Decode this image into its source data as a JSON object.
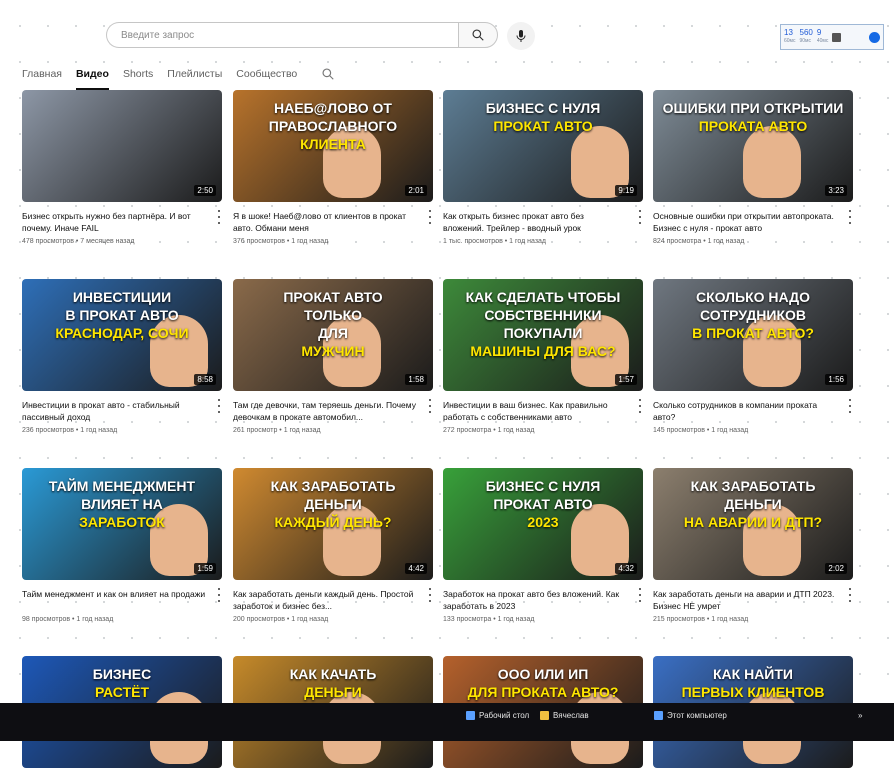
{
  "search": {
    "placeholder": "Введите запрос"
  },
  "tray": {
    "stats": [
      {
        "value": "13",
        "label": "60мс"
      },
      {
        "value": "560",
        "label": "90мс"
      },
      {
        "value": "9",
        "label": "40мс"
      }
    ]
  },
  "tabs": [
    {
      "label": "Главная",
      "active": false
    },
    {
      "label": "Видео",
      "active": true
    },
    {
      "label": "Shorts",
      "active": false
    },
    {
      "label": "Плейлисты",
      "active": false
    },
    {
      "label": "Сообщество",
      "active": false
    }
  ],
  "videos": [
    {
      "thumb_lines": [],
      "duration": "2:50",
      "title": "Бизнес открыть нужно без партнёра. И вот почему. Иначе FAIL",
      "meta": "478 просмотров • 7 месяцев назад",
      "bg": "#8d97a6"
    },
    {
      "thumb_lines": [
        "НАЕБ@ЛОВО ОТ",
        "ПРАВОСЛАВНОГО",
        "КЛИЕНТА"
      ],
      "duration": "2:01",
      "title": "Я в шоке! Наеб@ловo от клиентов в прокат авто. Обмани меня",
      "meta": "376 просмотров • 1 год назад",
      "bg": "#b8732b"
    },
    {
      "thumb_lines": [
        "БИЗНЕС С НУЛЯ",
        "ПРОКАТ АВТО"
      ],
      "duration": "9:19",
      "title": "Как открыть бизнес прокат авто без вложений. Трейлер - вводный урок",
      "meta": "1 тыс. просмотров • 1 год назад",
      "bg": "#5d7d94"
    },
    {
      "thumb_lines": [
        "ОШИБКИ ПРИ ОТКРЫТИИ",
        "ПРОКАТА АВТО"
      ],
      "duration": "3:23",
      "title": "Основные ошибки при открытии автопроката. Бизнес с нуля - прокат авто",
      "meta": "824 просмотра • 1 год назад",
      "bg": "#7e8b96"
    },
    {
      "thumb_lines": [
        "ИНВЕСТИЦИИ",
        "В ПРОКАТ АВТО",
        "КРАСНОДАР, СОЧИ"
      ],
      "duration": "8:58",
      "title": "Инвестиции в прокат авто - стабильный пассивный доход",
      "meta": "236 просмотров • 1 год назад",
      "bg": "#2e6fb8"
    },
    {
      "thumb_lines": [
        "ПРОКАТ АВТО",
        "ТОЛЬКО",
        "ДЛЯ",
        "МУЖЧИН"
      ],
      "duration": "1:58",
      "title": "Там где девочки, там теряешь деньги. Почему девочкам в прокате автомобил...",
      "meta": "261 просмотр • 1 год назад",
      "bg": "#8a6a4a"
    },
    {
      "thumb_lines": [
        "КАК СДЕЛАТЬ ЧТОБЫ",
        "СОБСТВЕННИКИ",
        "ПОКУПАЛИ",
        "МАШИНЫ ДЛЯ ВАС?"
      ],
      "duration": "1:57",
      "title": "Инвестиции в ваш бизнес. Как правильно работать с собственниками авто",
      "meta": "272 просмотра • 1 год назад",
      "bg": "#3d8a3a"
    },
    {
      "thumb_lines": [
        "СКОЛЬКО НАДО",
        "СОТРУДНИКОВ",
        "В ПРОКАТ АВТО?"
      ],
      "duration": "1:56",
      "title": "Сколько сотрудников в компании проката авто?",
      "meta": "145 просмотров • 1 год назад",
      "bg": "#6f7780"
    },
    {
      "thumb_lines": [
        "ТАЙМ МЕНЕДЖМЕНТ",
        "ВЛИЯЕТ НА",
        "ЗАРАБОТОК"
      ],
      "duration": "1:59",
      "title": "Тайм менеджмент и как он влияет на продажи",
      "meta": "98 просмотров • 1 год назад",
      "bg": "#2a9ad6"
    },
    {
      "thumb_lines": [
        "КАК ЗАРАБОТАТЬ",
        "ДЕНЬГИ",
        "КАЖДЫЙ ДЕНЬ?"
      ],
      "duration": "4:42",
      "title": "Как заработать деньги каждый день. Простой заработок и бизнес без...",
      "meta": "200 просмотров • 1 год назад",
      "bg": "#d08a30"
    },
    {
      "thumb_lines": [
        "БИЗНЕС С НУЛЯ",
        "ПРОКАТ АВТО",
        "2023"
      ],
      "duration": "4:32",
      "title": "Заработок на прокат авто без вложений. Как заработать в 2023",
      "meta": "133 просмотра • 1 год назад",
      "bg": "#38a13a"
    },
    {
      "thumb_lines": [
        "КАК ЗАРАБОТАТЬ",
        "ДЕНЬГИ",
        "НА АВАРИИ И ДТП?"
      ],
      "duration": "2:02",
      "title": "Как заработать деньги на аварии и ДТП 2023. Бизнес НЕ умрет",
      "meta": "215 просмотров • 1 год назад",
      "bg": "#8c7f6e"
    },
    {
      "thumb_lines": [
        "БИЗНЕС",
        "РАСТЁТ"
      ],
      "duration": "",
      "title": "",
      "meta": "",
      "bg": "#1d58b8"
    },
    {
      "thumb_lines": [
        "КАК КАЧАТЬ",
        "ДЕНЬГИ"
      ],
      "duration": "",
      "title": "",
      "meta": "",
      "bg": "#c68a2a"
    },
    {
      "thumb_lines": [
        "ООО ИЛИ ИП",
        "ДЛЯ ПРОКАТА АВТО?"
      ],
      "duration": "",
      "title": "",
      "meta": "",
      "bg": "#b5612c"
    },
    {
      "thumb_lines": [
        "КАК НАЙТИ",
        "ПЕРВЫХ КЛИЕНТОВ"
      ],
      "duration": "",
      "title": "",
      "meta": "",
      "bg": "#3a6fc4"
    }
  ],
  "taskbar": {
    "items": [
      {
        "label": "Рабочий стол"
      },
      {
        "label": "Вячеслав"
      },
      {
        "label": "Этот компьютер"
      }
    ],
    "overflow": "»"
  }
}
